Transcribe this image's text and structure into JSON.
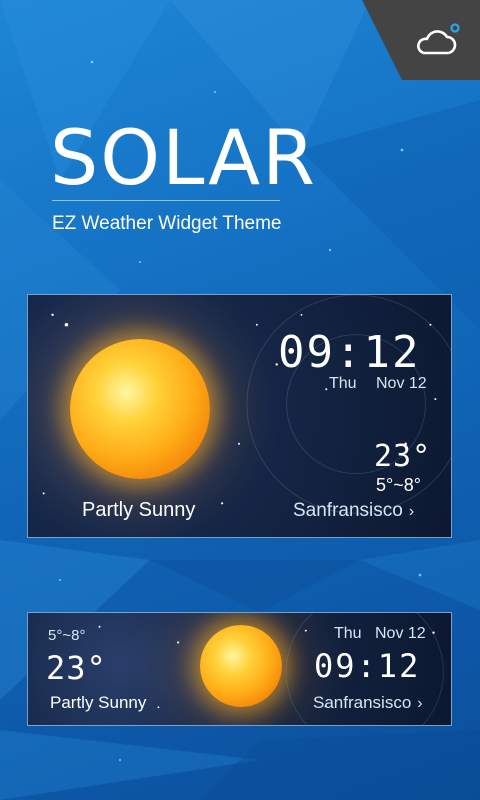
{
  "app": {
    "title": "SOLAR",
    "subtitle": "EZ Weather Widget Theme"
  },
  "icons": {
    "corner": "cloud-icon"
  },
  "widget_large": {
    "time": "09:12",
    "day": "Thu",
    "date": "Nov 12",
    "temperature": "23°",
    "range": "5°~8°",
    "condition": "Partly Sunny",
    "location": "Sanfransisco",
    "location_chevron": "›"
  },
  "widget_small": {
    "range": "5°~8°",
    "temperature": "23°",
    "condition": "Partly Sunny",
    "day": "Thu",
    "date": "Nov 12",
    "time": "09:12",
    "location": "Sanfransisco",
    "location_chevron": "›"
  },
  "colors": {
    "background": "#1470c2",
    "corner": "#444444",
    "card": "#152748",
    "sun": "#ffab16"
  }
}
